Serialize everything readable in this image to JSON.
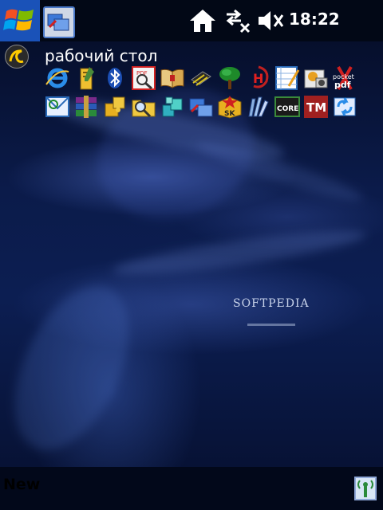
{
  "status_bar": {
    "time": "18:22"
  },
  "today": {
    "title": "рабочий стол"
  },
  "wallpaper": {
    "brand": "SOFTPEDIA"
  },
  "bottom_bar": {
    "left_softkey": "New"
  },
  "icons": {
    "row1": [
      "internet-explorer-icon",
      "pencil-notes-icon",
      "bluetooth-icon",
      "pdf-viewer-icon",
      "book-reader-icon",
      "chip-memory-icon",
      "tree-icon",
      "h-app-icon",
      "notepad-grid-icon",
      "photo-edit-icon",
      "pocket-pdf-icon"
    ],
    "row2": [
      "email-icon",
      "winrar-archive-icon",
      "puzzle-icon",
      "folder-search-icon",
      "puzzle-blue-icon",
      "remote-desktop-icon",
      "sk-box-icon",
      "books-icon",
      "core-icon",
      "tm-icon",
      "sync-icon"
    ]
  },
  "labels": {
    "pocket_pdf": "pocket pdf",
    "core": "CORE",
    "tm": "TM",
    "sk": "SK"
  },
  "colors": {
    "start_blue": "#1a52b8",
    "wallpaper_dark": "#0b1b4a",
    "status_bar": "#020816"
  }
}
